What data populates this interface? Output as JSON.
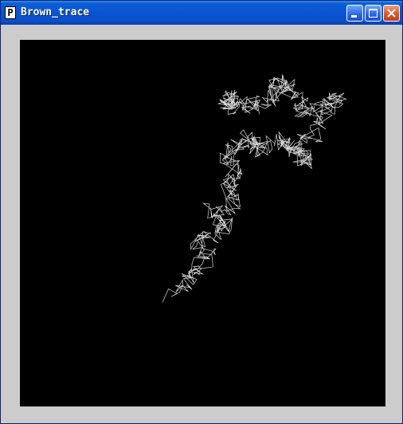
{
  "window": {
    "title": "Brown_trace",
    "app_icon_glyph": "P"
  },
  "controls": {
    "minimize_icon": "minimize-icon",
    "maximize_icon": "maximize-icon",
    "close_icon": "close-icon"
  },
  "colors": {
    "titlebar": "#0a53d2",
    "canvas_background": "#000000",
    "trace_stroke": "#ffffff",
    "window_frame": "#cccccc",
    "close_button": "#e0542a"
  }
}
